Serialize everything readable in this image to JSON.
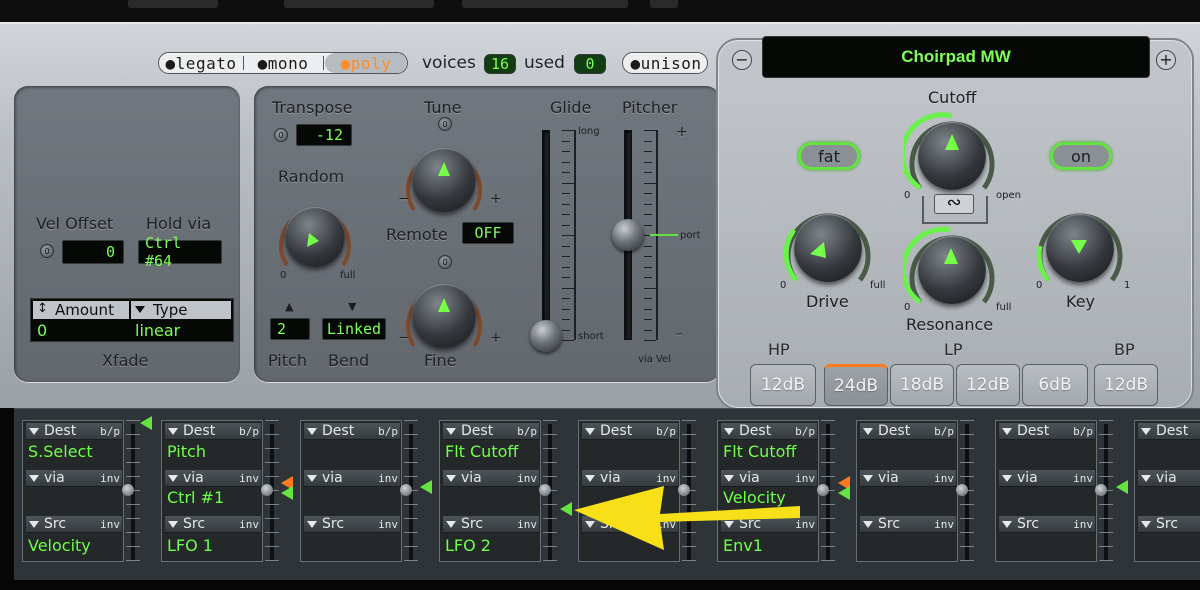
{
  "voice": {
    "modes": [
      "legato",
      "mono",
      "poly"
    ],
    "active_mode": "poly",
    "voices_label": "voices",
    "voices_value": "16",
    "used_label": "used",
    "used_value": "0",
    "unison_label": "unison"
  },
  "left_panel": {
    "vel_offset_label": "Vel Offset",
    "vel_offset_value": "0",
    "hold_via_label": "Hold via",
    "hold_via_value": "Ctrl #64",
    "xfade_amount_header": "Amount",
    "xfade_type_header": "Type",
    "xfade_amount_value": "0",
    "xfade_type_value": "linear",
    "xfade_label": "Xfade"
  },
  "tuning": {
    "transpose_label": "Transpose",
    "transpose_value": "-12",
    "tune_label": "Tune",
    "random_label": "Random",
    "random_min": "0",
    "random_max": "full",
    "remote_label": "Remote",
    "remote_value": "OFF",
    "fine_label": "Fine",
    "pitch_label": "Pitch",
    "bend_label": "Bend",
    "pitch_value": "2",
    "bend_value": "Linked",
    "minus": "−",
    "plus": "+",
    "zero": "0",
    "up_arrow": "▲",
    "down_arrow": "▼"
  },
  "glide": {
    "label": "Glide",
    "long_label": "long",
    "short_label": "short",
    "level": 0.02
  },
  "pitcher": {
    "label": "Pitcher",
    "plus": "+",
    "minus": "–",
    "port_label": "port",
    "via_vel_label": "via Vel",
    "level": 0.5
  },
  "filter": {
    "patch_name": "Choirpad MW",
    "minus_button": "−",
    "plus_button": "+",
    "fat_label": "fat",
    "on_label": "on",
    "cutoff_label": "Cutoff",
    "cutoff_min": "0",
    "cutoff_max": "open",
    "drive_label": "Drive",
    "drive_min": "0",
    "drive_max": "full",
    "resonance_label": "Resonance",
    "resonance_min": "0",
    "resonance_max": "full",
    "key_label": "Key",
    "key_min": "0",
    "key_max": "1",
    "link_glyph": "∾",
    "hp_label": "HP",
    "lp_label": "LP",
    "bp_label": "BP",
    "slopes": [
      "12dB",
      "24dB",
      "18dB",
      "12dB",
      "6dB",
      "12dB"
    ],
    "active_slope_index": 1,
    "accent_color": "#64e340"
  },
  "router": {
    "dest_label": "Dest",
    "bp_label": "b/p",
    "via_label": "via",
    "inv_label": "inv",
    "src_label": "Src",
    "slots": [
      {
        "dest": "S.Select",
        "via": "",
        "src": "Velocity"
      },
      {
        "dest": "Pitch",
        "via": "Ctrl #1",
        "src": "LFO 1"
      },
      {
        "dest": "",
        "via": "",
        "src": ""
      },
      {
        "dest": "Flt Cutoff",
        "via": "",
        "src": "LFO 2"
      },
      {
        "dest": "",
        "via": "",
        "src": ""
      },
      {
        "dest": "Flt Cutoff",
        "via": "Velocity",
        "src": "Env1"
      },
      {
        "dest": "",
        "via": "",
        "src": ""
      },
      {
        "dest": "",
        "via": "",
        "src": ""
      },
      {
        "dest": "",
        "via": "",
        "src": ""
      }
    ],
    "value_color": "#70ff4c",
    "arrow_color": "#f7e017"
  }
}
